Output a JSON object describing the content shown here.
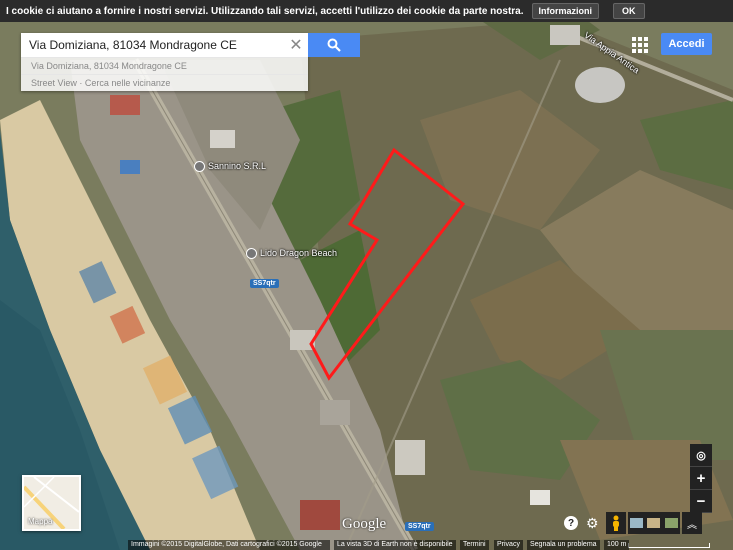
{
  "cookie_bar": {
    "message": "I cookie ci aiutano a fornire i nostri servizi. Utilizzando tali servizi, accetti l'utilizzo dei cookie da parte nostra.",
    "info_label": "Informazioni",
    "ok_label": "OK"
  },
  "search": {
    "value": "Via Domiziana, 81034 Mondragone CE",
    "suggestion_address": "Via Domiziana, 81034 Mondragone CE",
    "suggestion_actions": "Street View · Cerca nelle vicinanze"
  },
  "header": {
    "signin_label": "Accedi"
  },
  "map_labels": {
    "road_appia": "Via Appia Antica",
    "poi_sannino": "Sannino S.R.L",
    "poi_lido": "Lido Dragon Beach",
    "route_ss7": "SS7qtr",
    "route_ss7_bottom": "SS7qtr"
  },
  "thumbnail": {
    "label": "Mappa"
  },
  "controls": {
    "help": "?",
    "zoom_in": "+",
    "zoom_out": "−"
  },
  "logo": "Google",
  "footer": {
    "imagery": "Immagini ©2015 DigitalGlobe, Dati cartografici ©2015 Google",
    "earth_3d": "La vista 3D di Earth non è disponibile",
    "terms": "Termini",
    "privacy": "Privacy",
    "report": "Segnala un problema",
    "scale": "100 m"
  },
  "colors": {
    "sea": "#2f5f6a",
    "beach": "#d9c9a3",
    "road": "#b8b2a0",
    "highlight": "#ff1a1a",
    "accent": "#4a8af4"
  }
}
